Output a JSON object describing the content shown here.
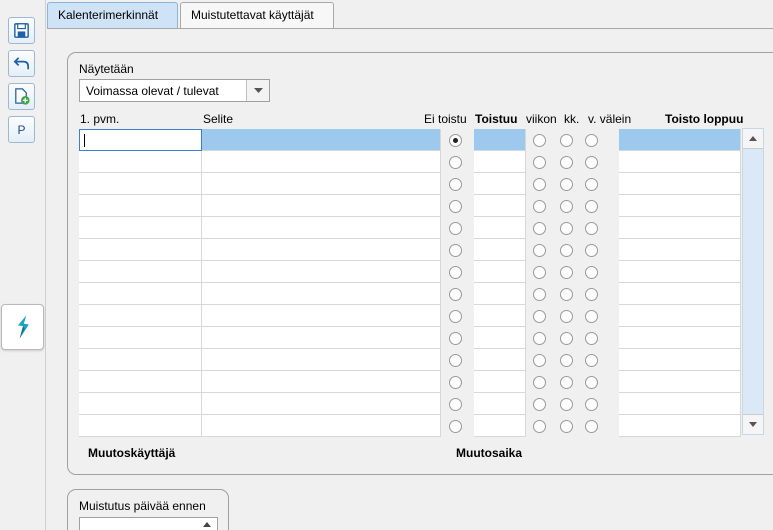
{
  "tabs": [
    {
      "label": "Kalenterimerkinnät",
      "active": true
    },
    {
      "label": "Muistutettavat käyttäjät",
      "active": false
    }
  ],
  "toolbar": {
    "save_icon": "save-icon",
    "undo_icon": "undo-icon",
    "new_icon": "new-document-icon",
    "p_label": "P",
    "logo_icon": "app-logo-icon"
  },
  "filter": {
    "label": "Näytetään",
    "value": "Voimassa olevat / tulevat"
  },
  "grid": {
    "headers": {
      "date": "1. pvm.",
      "desc": "Selite",
      "no_repeat": "Ei toistu",
      "repeats": "Toistuu",
      "week": "viikon",
      "month": "kk.",
      "interval": "v. välein",
      "repeat_end": "Toisto loppuu"
    },
    "row_count": 14,
    "checked_row": 0
  },
  "footer": {
    "modifier_label": "Muutoskäyttäjä",
    "modified_label": "Muutosaika"
  },
  "reminder": {
    "label": "Muistutus päivää ennen",
    "value": ""
  },
  "colors": {
    "selection": "#9dc9ee",
    "tab_active": "#cfe3f7",
    "scroll_track": "#dbe9f7"
  }
}
